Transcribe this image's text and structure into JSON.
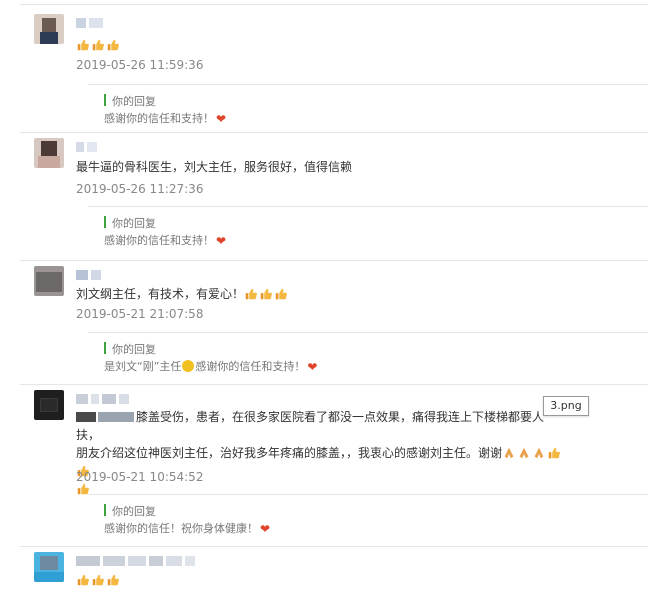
{
  "icons": {
    "thumbs_up": "thumbs-up-icon",
    "heart": "heart-icon",
    "smiley": "smiley-icon",
    "pray": "pray-hands-icon"
  },
  "colors": {
    "divider": "#e6e6e6",
    "reply_bar": "#3da33d",
    "heart": "#e0462b",
    "thumb": "#f0a830",
    "timestamp": "#888888",
    "reply_text": "#777777"
  },
  "comments": [
    {
      "text": "",
      "thumbs_after": 3,
      "time": "2019-05-26 11:59:36",
      "reply": {
        "label": "你的回复",
        "text": "感谢你的信任和支持！"
      }
    },
    {
      "text": "最牛逼的骨科医生，刘大主任，服务很好，值得信赖",
      "time": "2019-05-26 11:27:36",
      "reply": {
        "label": "你的回复",
        "text": "感谢你的信任和支持！"
      }
    },
    {
      "text": "刘文纲主任，有技术，有爱心！",
      "thumbs_after": 3,
      "time": "2019-05-21 21:07:58",
      "reply": {
        "label": "你的回复",
        "text_before": "是刘文“刚”主任",
        "text_after": "感谢你的信任和支持！"
      }
    },
    {
      "text_line1": "膝盖受伤，患者，在很多家医院看了都没一点效果，痛得我连上下楼梯都要人扶，",
      "text_line2": "朋友介绍这位神医刘主任，治好我多年疼痛的膝盖，，我衷心的感谢刘主任。谢谢",
      "time": "2019-05-21 10:54:52",
      "reply": {
        "label": "你的回复",
        "text": "感谢你的信任！祝你身体健康！"
      }
    },
    {
      "thumbs_after": 3
    }
  ],
  "tooltip": {
    "text": "3.png"
  }
}
